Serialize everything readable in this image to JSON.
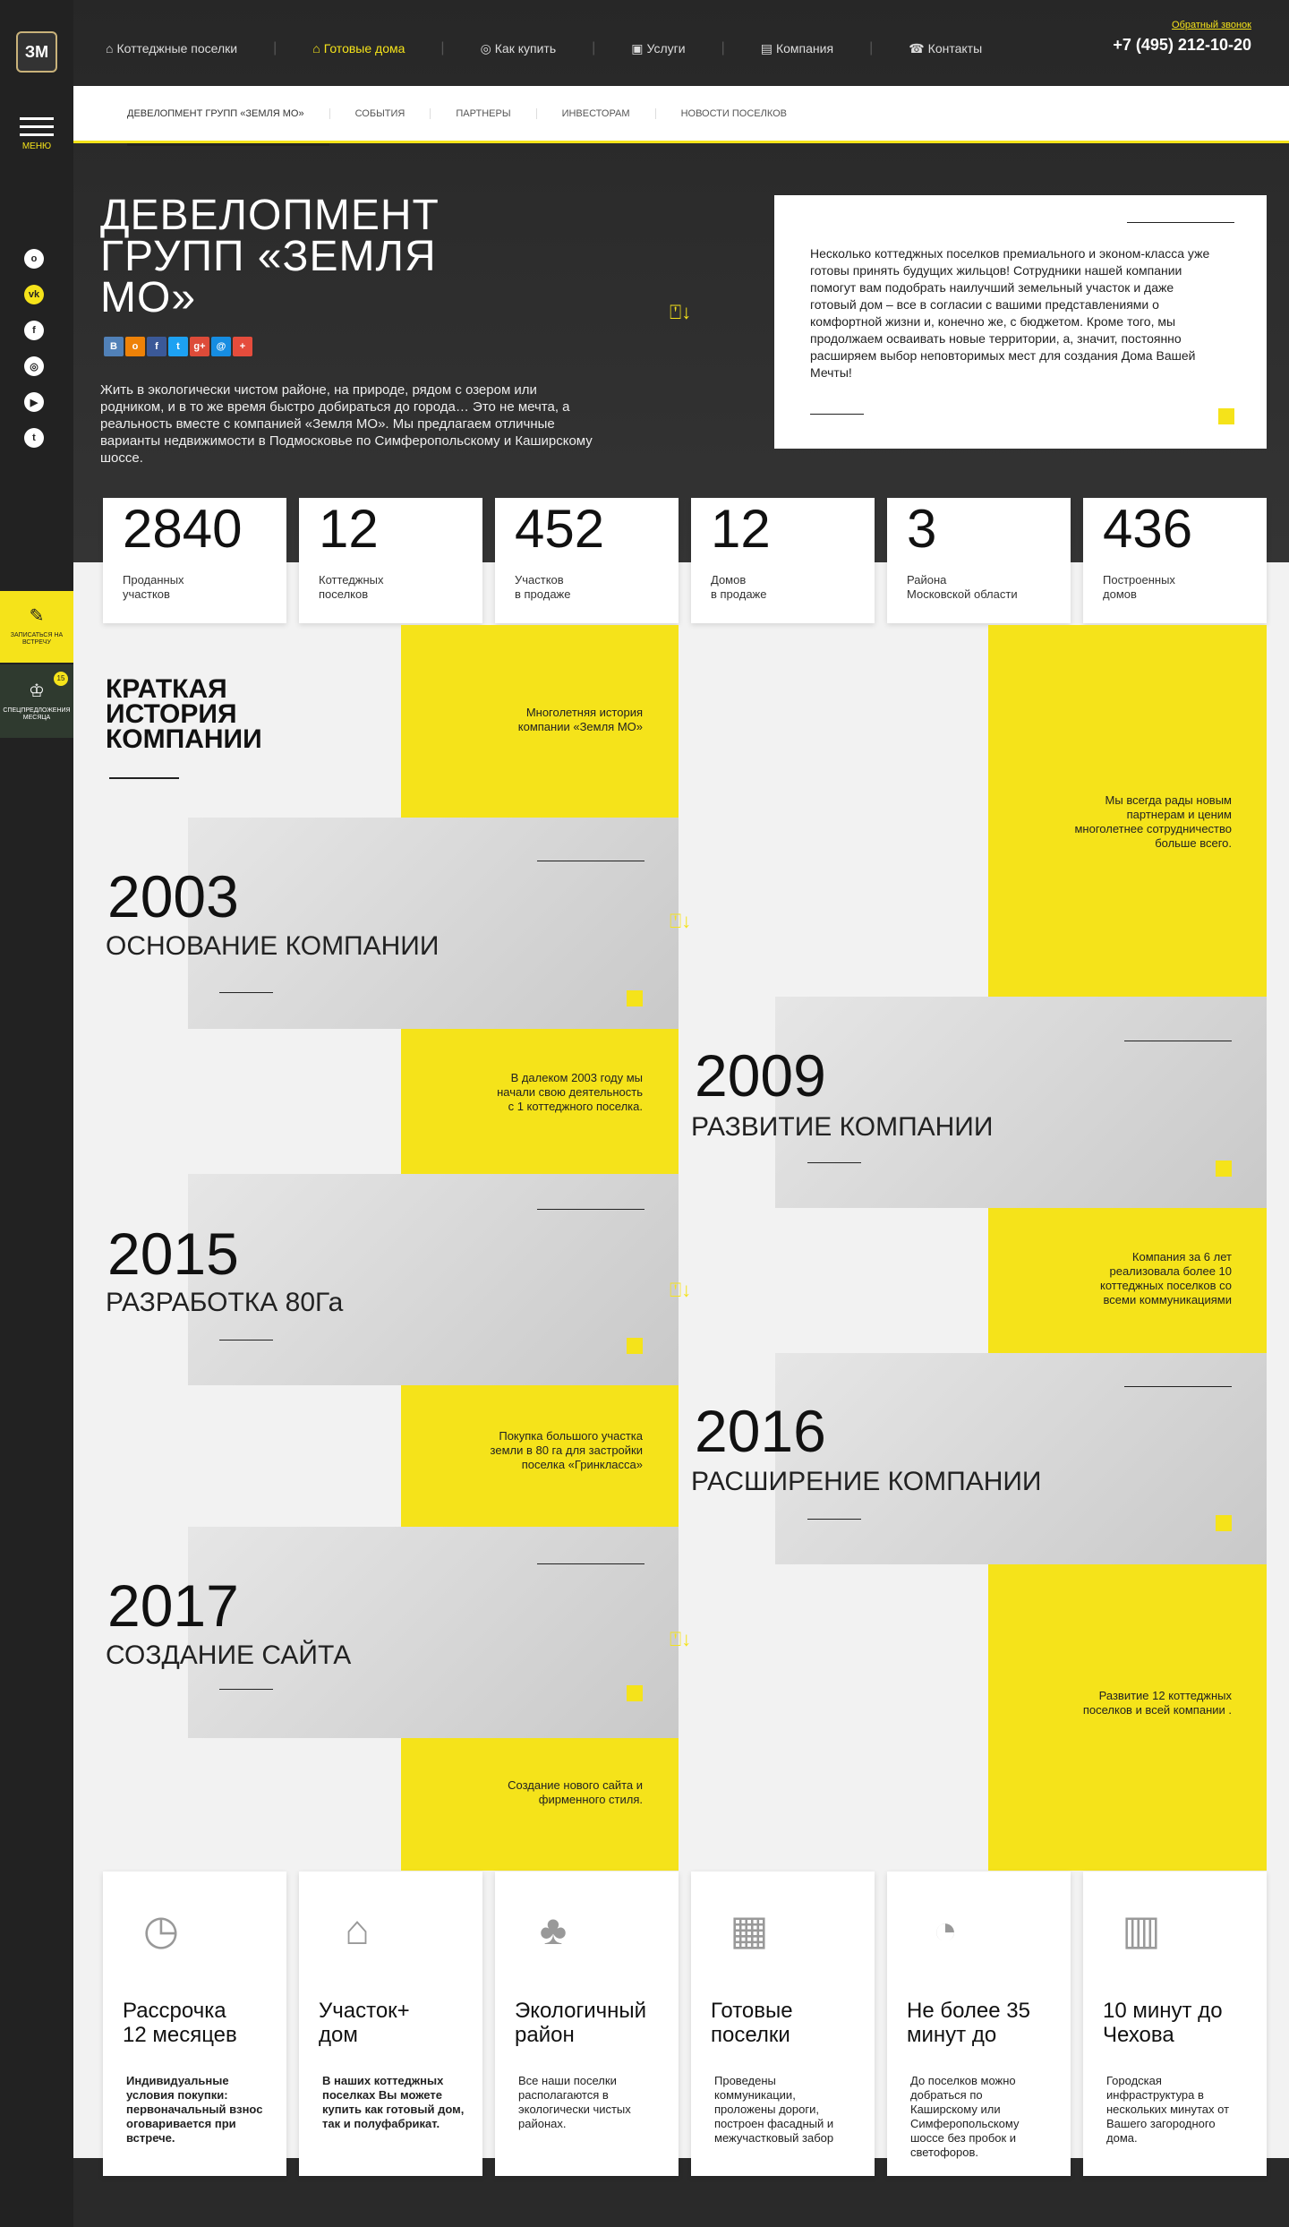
{
  "logo": {
    "text": "ЗМ"
  },
  "sidebar": {
    "menu_label": "МЕНЮ",
    "socials": [
      "ok",
      "vk",
      "f",
      "ig",
      "yt",
      "tw"
    ],
    "meet_label": "ЗАПИСАТЬСЯ НА ВСТРЕЧУ",
    "offer_label": "СПЕЦПРЕДЛОЖЕНИЯ МЕСЯЦА",
    "offer_badge": "15"
  },
  "nav": {
    "items": [
      {
        "label": "Коттеджные поселки",
        "icon": "house-icon"
      },
      {
        "label": "Готовые дома",
        "icon": "home-icon"
      },
      {
        "label": "Как купить",
        "icon": "money-icon"
      },
      {
        "label": "Услуги",
        "icon": "services-icon"
      },
      {
        "label": "Компания",
        "icon": "company-icon"
      },
      {
        "label": "Контакты",
        "icon": "contacts-icon"
      }
    ],
    "callback": "Обратный звонок",
    "phone": "+7 (495) 212-10-20"
  },
  "subnav": [
    "ДЕВЕЛОПМЕНТ ГРУПП «ЗЕМЛЯ МО»",
    "СОБЫТИЯ",
    "ПАРТНЕРЫ",
    "ИНВЕСТОРАМ",
    "НОВОСТИ ПОСЕЛКОВ"
  ],
  "hero": {
    "title": "ДЕВЕЛОПМЕНТ ГРУПП «ЗЕМЛЯ МО»",
    "description": "Жить в экологически чистом районе, на природе, рядом с озером или родником, и в то же время быстро добираться до города… Это не мечта, а реальность вместе с компанией «Земля МО». Мы предлагаем отличные варианты недвижимости в Подмосковье по Симферопольскому и Каширскому шоссе.",
    "card_text": "Несколько коттеджных поселков премиального и эконом-класса уже готовы принять будущих жильцов! Сотрудники нашей компании помогут вам подобрать наилучший земельный участок и даже готовый дом – все в согласии с вашими представлениями о комфортной жизни и, конечно же, с бюджетом. Кроме того, мы продолжаем осваивать новые территории, а, значит, постоянно расширяем выбор неповторимых мест для создания Дома Вашей Мечты!",
    "share": [
      {
        "label": "В",
        "color": "#5181b8"
      },
      {
        "label": "о",
        "color": "#ee8208"
      },
      {
        "label": "f",
        "color": "#3b5998"
      },
      {
        "label": "t",
        "color": "#1da1f2"
      },
      {
        "label": "g+",
        "color": "#dd4b39"
      },
      {
        "label": "@",
        "color": "#168de2"
      },
      {
        "label": "+",
        "color": "#e54c3c"
      }
    ]
  },
  "stats": [
    {
      "num": "2840",
      "label": "Проданных\nучастков"
    },
    {
      "num": "12",
      "label": "Коттеджных\nпоселков"
    },
    {
      "num": "452",
      "label": "Участков\nв продаже"
    },
    {
      "num": "12",
      "label": "Домов\nв продаже"
    },
    {
      "num": "3",
      "label": "Района\nМосковской области"
    },
    {
      "num": "436",
      "label": "Построенных\nдомов"
    }
  ],
  "history": {
    "title": "КРАТКАЯ ИСТОРИЯ КОМПАНИИ",
    "intro": "Многолетняя история компании «Земля МО»",
    "partners": "Мы всегда рады новым партнерам и ценим многолетнее сотрудничество больше всего.",
    "y2003": {
      "year": "2003",
      "title": "ОСНОВАНИЕ КОМПАНИИ",
      "text": "В далеком 2003 году мы начали свою деятельность с 1 коттеджного поселка."
    },
    "y2009": {
      "year": "2009",
      "title": "РАЗВИТИЕ КОМПАНИИ",
      "text": "Компания за 6 лет реализовала более 10 коттеджных поселков со всеми коммуникациями"
    },
    "y2015": {
      "year": "2015",
      "title": "РАЗРАБОТКА 80Га",
      "text": "Покупка большого участка земли в 80 га для застройки поселка «Гринкласса»"
    },
    "y2016": {
      "year": "2016",
      "title": "РАСШИРЕНИЕ КОМПАНИИ",
      "text": "Развитие  12 коттеджных поселков  и всей компании ."
    },
    "y2017": {
      "year": "2017",
      "title": "СОЗДАНИЕ САЙТА",
      "text": "Создание нового  сайта и фирменного стиля."
    }
  },
  "features": [
    {
      "icon": "clock-icon",
      "glyph": "◷",
      "title": "Рассрочка\n12 месяцев",
      "desc": "Индивидуальные условия покупки: первоначальный взнос оговаривается при встрече.",
      "bold": true
    },
    {
      "icon": "house-plot-icon",
      "glyph": "⌂",
      "title": "Участок+\nдом",
      "desc": "В наших коттеджных поселках Вы можете купить как готовый дом, так и полуфабрикат.",
      "bold": true
    },
    {
      "icon": "forest-icon",
      "glyph": "♣",
      "title": "Экологичный\nрайон",
      "desc": "Все наши поселки располагаются в экологически чистых районах.",
      "bold": false
    },
    {
      "icon": "buildings-icon",
      "glyph": "▦",
      "title": "Готовые\nпоселки",
      "desc": "Проведены коммуникации, проложены дороги, построен фасадный и межучастковый забор",
      "bold": false
    },
    {
      "icon": "stopwatch-icon",
      "glyph": "◔",
      "title": "Не более 35\nминут до",
      "desc": "До поселков можно добраться по Каширскому или Симферопольскому шоссе без пробок и светофоров.",
      "bold": false
    },
    {
      "icon": "city-icon",
      "glyph": "▥",
      "title": "10 минут до\nЧехова",
      "desc": "Городская инфраструктура в нескольких минутах от Вашего загородного дома.",
      "bold": false
    }
  ],
  "colors": {
    "accent": "#f5e31a",
    "dark": "#222222"
  }
}
